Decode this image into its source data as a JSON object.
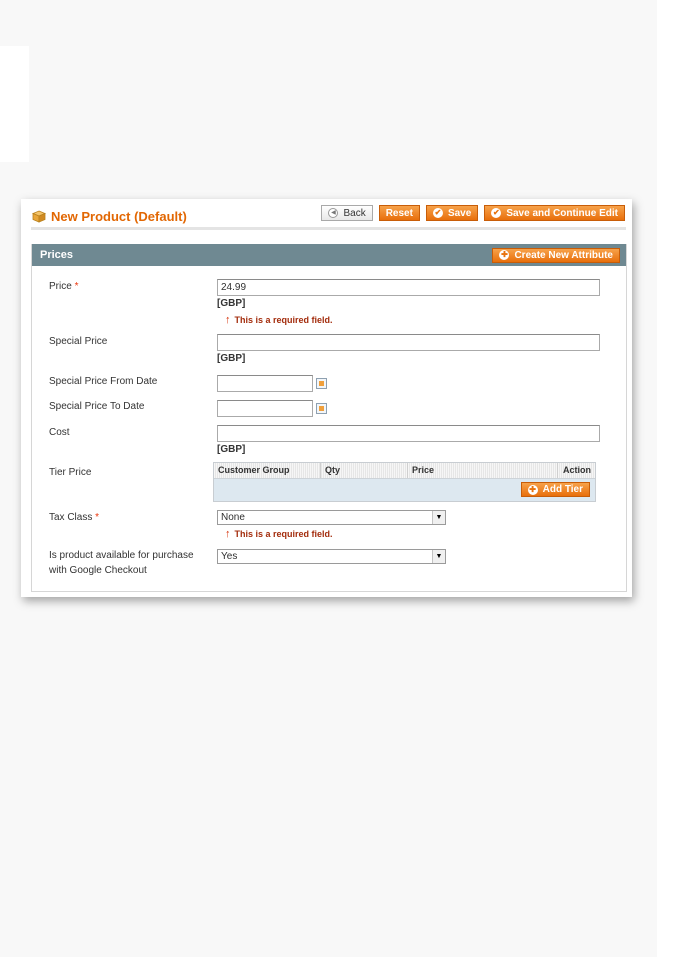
{
  "header": {
    "title": "New Product (Default)",
    "buttons": {
      "back": "Back",
      "reset": "Reset",
      "save": "Save",
      "save_continue": "Save and Continue Edit"
    }
  },
  "section": {
    "title": "Prices",
    "create_attribute_label": "Create New Attribute"
  },
  "fields": {
    "price": {
      "label": "Price",
      "required_mark": "*",
      "value": "24.99",
      "unit": "[GBP]",
      "error": "This is a required field."
    },
    "special_price": {
      "label": "Special Price",
      "value": "",
      "unit": "[GBP]"
    },
    "special_from": {
      "label": "Special Price From Date",
      "value": ""
    },
    "special_to": {
      "label": "Special Price To Date",
      "value": ""
    },
    "cost": {
      "label": "Cost",
      "value": "",
      "unit": "[GBP]"
    },
    "tier_price": {
      "label": "Tier Price",
      "columns": [
        "Customer Group",
        "Qty",
        "Price",
        "Action"
      ],
      "add_label": "Add Tier"
    },
    "tax_class": {
      "label": "Tax Class",
      "required_mark": "*",
      "value": "None",
      "error": "This is a required field."
    },
    "google_checkout": {
      "label_line1": "Is product available for purchase",
      "label_line2": "with Google Checkout",
      "value": "Yes"
    }
  },
  "icons": {
    "product": "box-icon",
    "back": "arrow-left-icon",
    "save": "check-circle-icon",
    "add": "plus-circle-icon",
    "calendar": "calendar-icon",
    "error": "arrow-up-icon"
  },
  "colors": {
    "accent": "#e86f0c",
    "title": "#e26703",
    "section_header": "#6f8992",
    "error_text": "#a32c0c",
    "required": "#eb340a",
    "tier_body": "#dde8f0"
  }
}
